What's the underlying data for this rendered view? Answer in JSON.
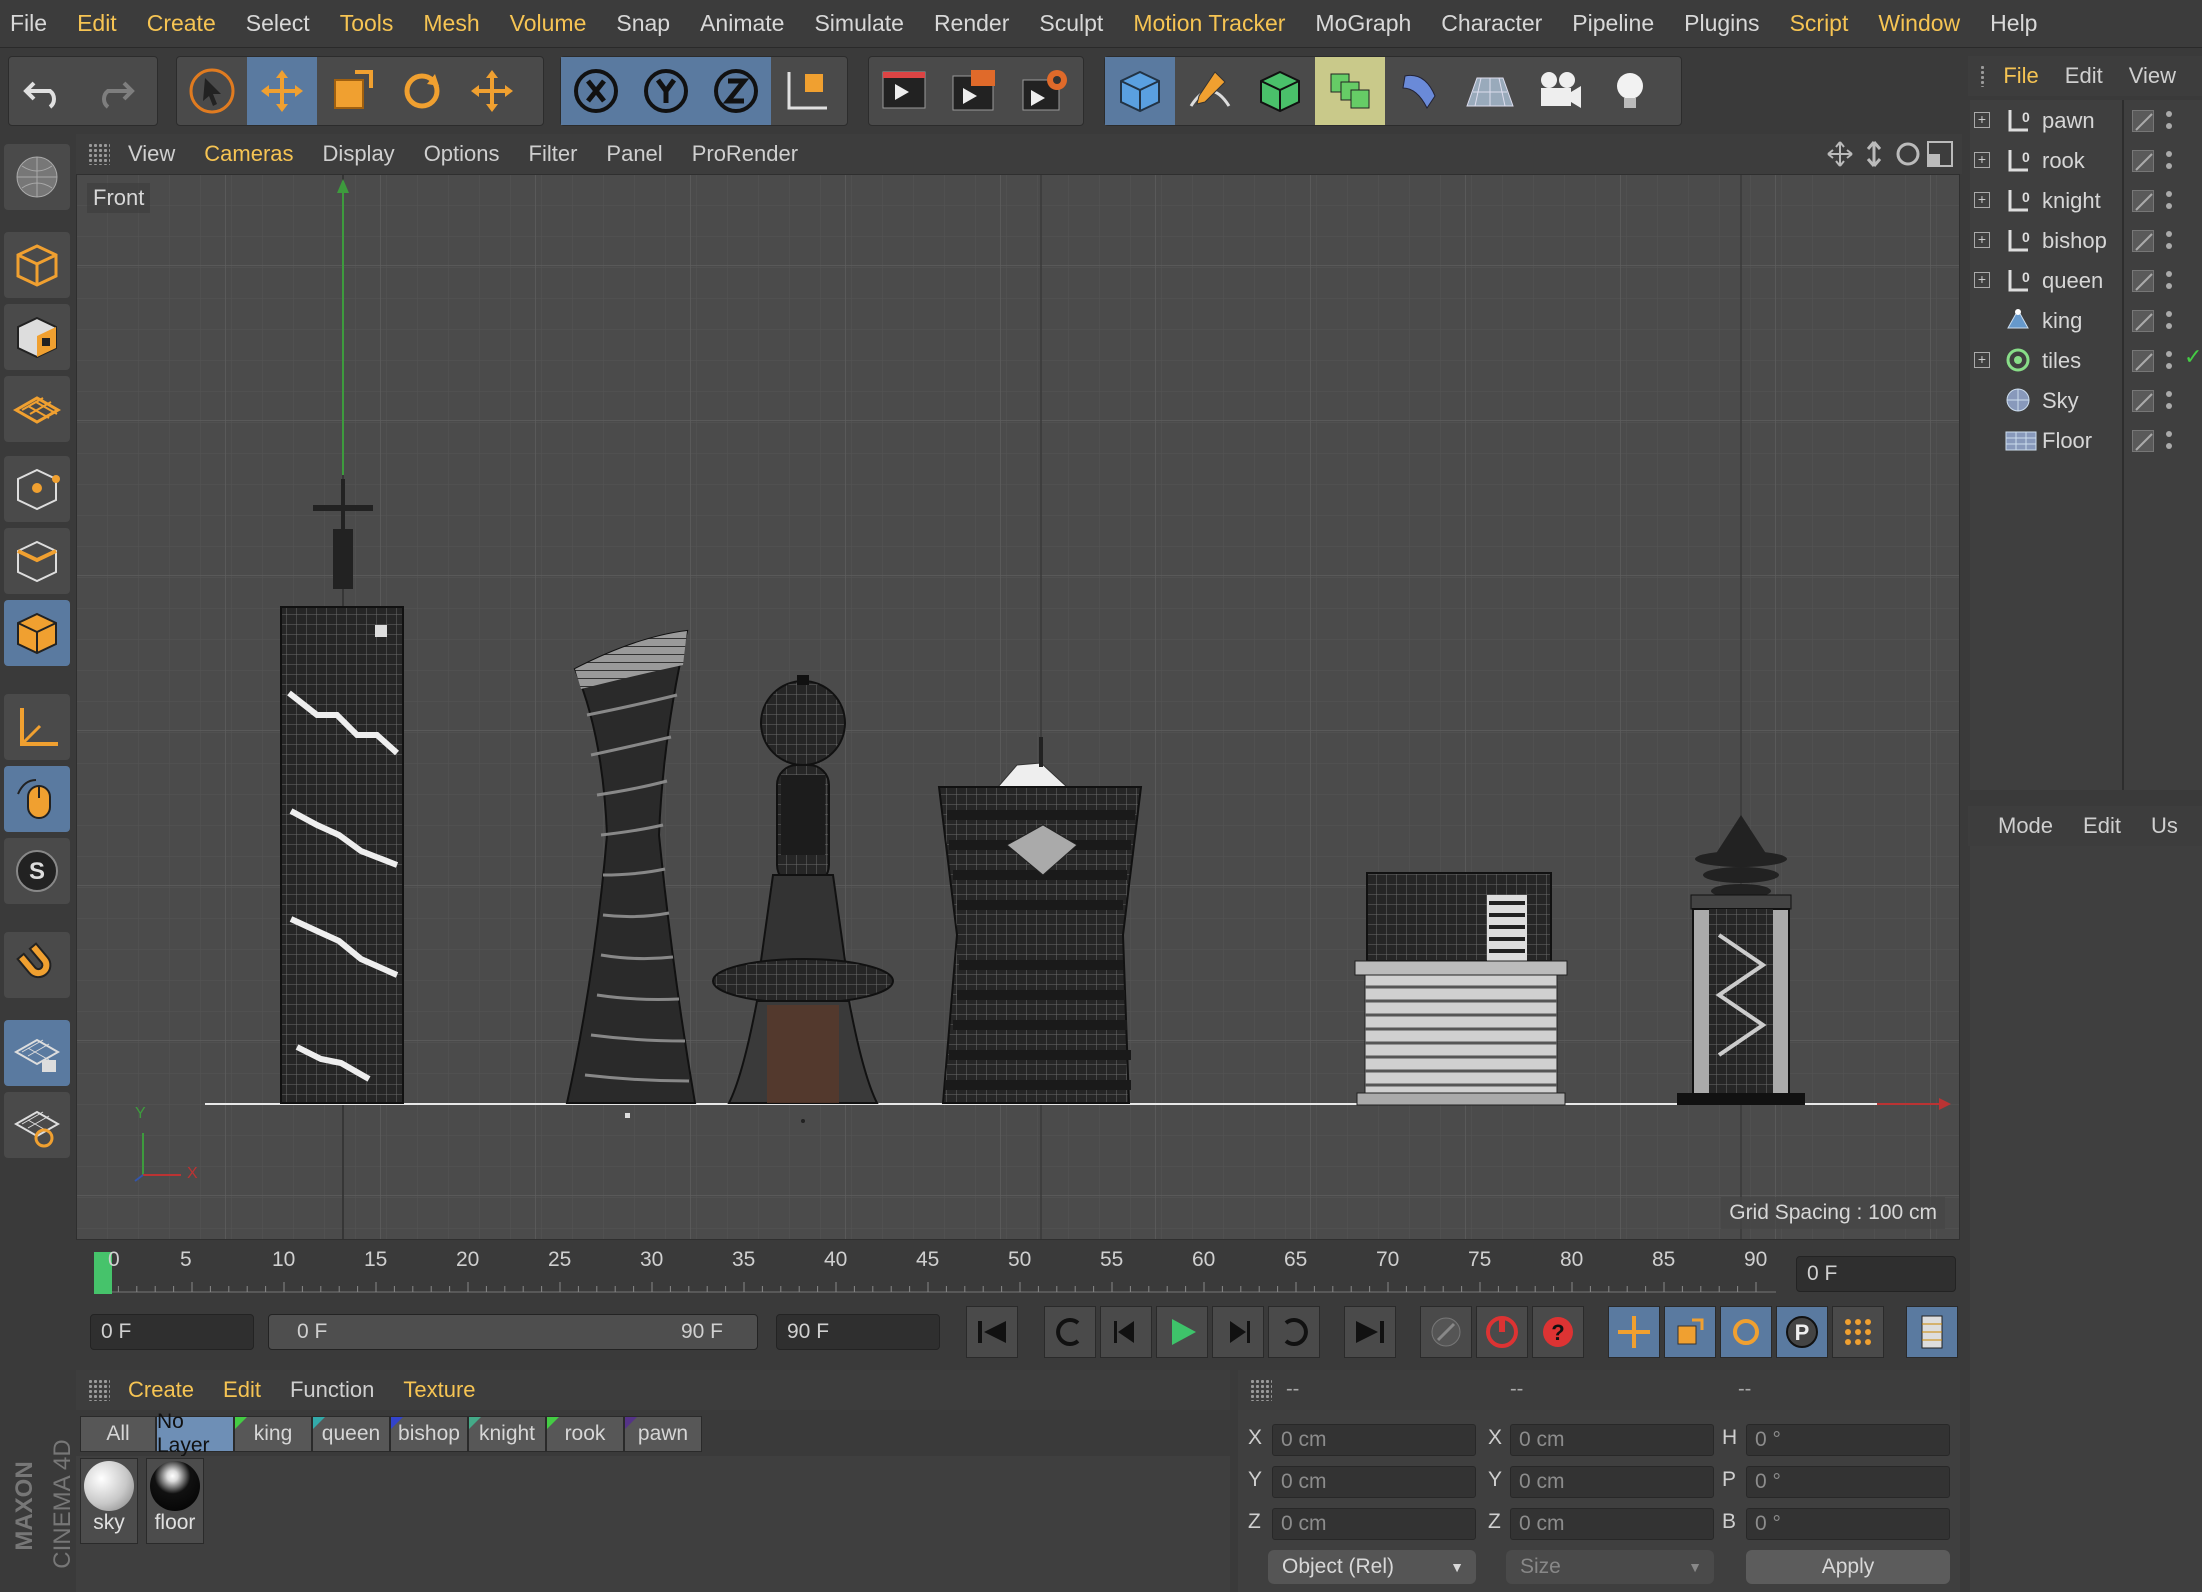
{
  "menubar": {
    "items": [
      "File",
      "Edit",
      "Create",
      "Select",
      "Tools",
      "Mesh",
      "Volume",
      "Snap",
      "Animate",
      "Simulate",
      "Render",
      "Sculpt",
      "Motion Tracker",
      "MoGraph",
      "Character",
      "Pipeline",
      "Plugins",
      "Script",
      "Window",
      "Help"
    ],
    "highlighted": [
      "Edit",
      "Create",
      "Tools",
      "Mesh",
      "Volume",
      "Motion Tracker",
      "Script",
      "Window"
    ]
  },
  "viewport": {
    "menu": [
      "View",
      "Cameras",
      "Display",
      "Options",
      "Filter",
      "Panel",
      "ProRender"
    ],
    "highlighted": [
      "Cameras"
    ],
    "label": "Front",
    "grid_spacing": "Grid Spacing : 100 cm",
    "axis_y": "Y",
    "axis_x": "X",
    "objects": [
      "king",
      "queen",
      "bishop",
      "knight",
      "rook",
      "pawn"
    ]
  },
  "timeline": {
    "ticks": [
      "0",
      "5",
      "10",
      "15",
      "20",
      "25",
      "30",
      "35",
      "40",
      "45",
      "50",
      "55",
      "60",
      "65",
      "70",
      "75",
      "80",
      "85",
      "90"
    ],
    "current_frame": "0 F"
  },
  "transport": {
    "start": "0 F",
    "range_start": "0 F",
    "range_end": "90 F",
    "end": "90 F"
  },
  "materials": {
    "menu": [
      "Create",
      "Edit",
      "Function",
      "Texture"
    ],
    "highlighted": [
      "Create",
      "Edit",
      "Texture"
    ],
    "layers": [
      "All",
      "No Layer",
      "king",
      "queen",
      "bishop",
      "knight",
      "rook",
      "pawn"
    ],
    "selected_layer": "No Layer",
    "items": [
      "sky",
      "floor"
    ]
  },
  "coordinates": {
    "headers": [
      "--",
      "--",
      "--"
    ],
    "pos": {
      "x": "0 cm",
      "y": "0 cm",
      "z": "0 cm"
    },
    "size": {
      "x": "0 cm",
      "y": "0 cm",
      "z": "0 cm"
    },
    "rot": {
      "h": "0 °",
      "p": "0 °",
      "b": "0 °"
    },
    "labels": {
      "x": "X",
      "y": "Y",
      "z": "Z",
      "h": "H",
      "p": "P",
      "b": "B"
    },
    "mode": "Object (Rel)",
    "size_mode": "Size",
    "apply": "Apply"
  },
  "object_manager": {
    "menu": [
      "File",
      "Edit",
      "View"
    ],
    "objects": [
      {
        "name": "pawn",
        "icon": "null-icon"
      },
      {
        "name": "rook",
        "icon": "null-icon"
      },
      {
        "name": "knight",
        "icon": "null-icon"
      },
      {
        "name": "bishop",
        "icon": "null-icon"
      },
      {
        "name": "queen",
        "icon": "null-icon"
      },
      {
        "name": "king",
        "icon": "light-icon"
      },
      {
        "name": "tiles",
        "icon": "cloner-icon"
      },
      {
        "name": "Sky",
        "icon": "sky-icon"
      },
      {
        "name": "Floor",
        "icon": "floor-icon"
      }
    ]
  },
  "attributes": {
    "menu": [
      "Mode",
      "Edit",
      "Us"
    ]
  },
  "brand": {
    "maker": "MAXON",
    "product": "CINEMA 4D"
  },
  "colors": {
    "accent": "#f6c453",
    "selection": "#5a7aa0",
    "background": "#3a3a3a",
    "viewport": "#4b4b4b"
  }
}
